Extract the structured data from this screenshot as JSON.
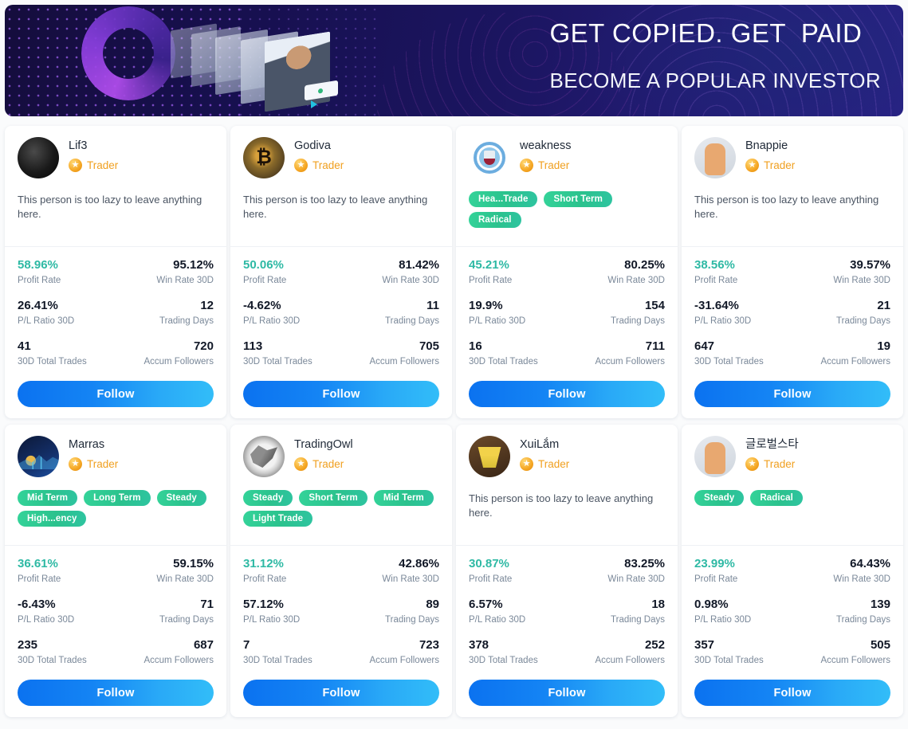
{
  "banner": {
    "headline": "GET COPIED. GET  PAID",
    "subline": "BECOME A POPULAR INVESTOR"
  },
  "labels": {
    "profit_rate": "Profit Rate",
    "win_rate": "Win Rate 30D",
    "pl_ratio": "P/L Ratio 30D",
    "trading_days": "Trading Days",
    "total_trades": "30D Total Trades",
    "accum_followers": "Accum Followers",
    "follow": "Follow",
    "trader": "Trader",
    "empty_bio": "This person is too lazy to leave anything here."
  },
  "colors": {
    "positive": "#2eb9a4",
    "tag": "#2bc28d",
    "badge": "#f0a020",
    "follow_start": "#0b72f0",
    "follow_end": "#32bdf8"
  },
  "cards": [
    {
      "name": "Lif3",
      "avatar": "av-lif3",
      "badge": "Trader",
      "bio": "This person is too lazy to leave anything here.",
      "tags": [],
      "profit_rate": "58.96%",
      "win_rate": "95.12%",
      "pl_ratio": "26.41%",
      "trading_days": "12",
      "total_trades": "41",
      "accum_followers": "720",
      "follow": "Follow"
    },
    {
      "name": "Godiva",
      "avatar": "av-godiva",
      "badge": "Trader",
      "bio": "This person is too lazy to leave anything here.",
      "tags": [],
      "profit_rate": "50.06%",
      "win_rate": "81.42%",
      "pl_ratio": "-4.62%",
      "trading_days": "11",
      "total_trades": "113",
      "accum_followers": "705",
      "follow": "Follow"
    },
    {
      "name": "weakness",
      "avatar": "av-weak",
      "badge": "Trader",
      "bio": "",
      "tags": [
        "Hea...Trade",
        "Short Term",
        "Radical"
      ],
      "profit_rate": "45.21%",
      "win_rate": "80.25%",
      "pl_ratio": "19.9%",
      "trading_days": "154",
      "total_trades": "16",
      "accum_followers": "711",
      "follow": "Follow"
    },
    {
      "name": "Bnappie",
      "avatar": "av-bnappie",
      "badge": "Trader",
      "bio": "This person is too lazy to leave anything here.",
      "tags": [],
      "profit_rate": "38.56%",
      "win_rate": "39.57%",
      "pl_ratio": "-31.64%",
      "trading_days": "21",
      "total_trades": "647",
      "accum_followers": "19",
      "follow": "Follow"
    },
    {
      "name": "Marras",
      "avatar": "av-marras",
      "badge": "Trader",
      "bio": "",
      "tags": [
        "Mid Term",
        "Long Term",
        "Steady",
        "High...ency"
      ],
      "profit_rate": "36.61%",
      "win_rate": "59.15%",
      "pl_ratio": "-6.43%",
      "trading_days": "71",
      "total_trades": "235",
      "accum_followers": "687",
      "follow": "Follow"
    },
    {
      "name": "TradingOwl",
      "avatar": "av-owl",
      "badge": "Trader",
      "bio": "",
      "tags": [
        "Steady",
        "Short Term",
        "Mid Term",
        "Light Trade"
      ],
      "profit_rate": "31.12%",
      "win_rate": "42.86%",
      "pl_ratio": "57.12%",
      "trading_days": "89",
      "total_trades": "7",
      "accum_followers": "723",
      "follow": "Follow"
    },
    {
      "name": "XuiLắm",
      "avatar": "av-xui",
      "badge": "Trader",
      "bio": "This person is too lazy to leave anything here.",
      "tags": [],
      "profit_rate": "30.87%",
      "win_rate": "83.25%",
      "pl_ratio": "6.57%",
      "trading_days": "18",
      "total_trades": "378",
      "accum_followers": "252",
      "follow": "Follow"
    },
    {
      "name": "글로벌스타",
      "avatar": "av-korean",
      "badge": "Trader",
      "bio": "",
      "tags": [
        "Steady",
        "Radical"
      ],
      "profit_rate": "23.99%",
      "win_rate": "64.43%",
      "pl_ratio": "0.98%",
      "trading_days": "139",
      "total_trades": "357",
      "accum_followers": "505",
      "follow": "Follow"
    }
  ]
}
